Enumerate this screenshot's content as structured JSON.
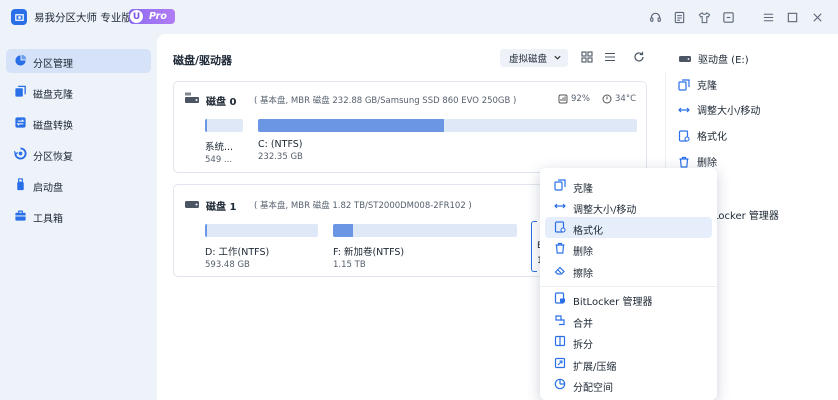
{
  "app": {
    "title": "易我分区大师 专业版",
    "badge_u": "U",
    "badge_text": "Pro"
  },
  "titlebar_icons": [
    "headset-icon",
    "feedback-icon",
    "tshirt-icon",
    "window-icon",
    "menu-icon",
    "minimize-icon",
    "maximize-icon",
    "close-icon"
  ],
  "sidebar": {
    "items": [
      {
        "label": "分区管理",
        "icon": "pie-icon",
        "active": true
      },
      {
        "label": "磁盘克隆",
        "icon": "clone-icon",
        "active": false
      },
      {
        "label": "磁盘转换",
        "icon": "convert-icon",
        "active": false
      },
      {
        "label": "分区恢复",
        "icon": "recover-icon",
        "active": false
      },
      {
        "label": "启动盘",
        "icon": "usb-icon",
        "active": false
      },
      {
        "label": "工具箱",
        "icon": "toolbox-icon",
        "active": false
      }
    ]
  },
  "main": {
    "title": "磁盘/驱动器",
    "view_select": "虚拟磁盘"
  },
  "disks": [
    {
      "name": "磁盘 0",
      "info": "( 基本盘, MBR 磁盘 232.88 GB/Samsung SSD 860 EVO 250GB )",
      "health": "92%",
      "temp": "34°C",
      "partitions": [
        {
          "name": "系统...",
          "size": "549 ...",
          "used": 0.05
        },
        {
          "name": "C: (NTFS)",
          "size": "232.35 GB",
          "used": 0.49
        }
      ]
    },
    {
      "name": "磁盘 1",
      "info": "( 基本盘, MBR 磁盘 1.82 TB/ST2000DM008-2FR102 )",
      "partitions": [
        {
          "name": "D: 工作(NTFS)",
          "size": "593.48 GB",
          "used": 0.02
        },
        {
          "name": "F: 新加卷(NTFS)",
          "size": "1.15 TB",
          "used": 0.11
        }
      ],
      "partial_partition": {
        "name": "E",
        "size": "1"
      }
    }
  ],
  "right_panel": {
    "header": "驱动盘 (E:)",
    "items": [
      {
        "label": "克隆",
        "icon": "clone-icon"
      },
      {
        "label": "调整大小/移动",
        "icon": "resize-icon"
      },
      {
        "label": "格式化",
        "icon": "format-icon"
      },
      {
        "label": "删除",
        "icon": "delete-icon"
      },
      {
        "label": "t",
        "icon": ""
      },
      {
        "label": "Locker 管理器",
        "icon": ""
      }
    ]
  },
  "context_menu": {
    "items": [
      {
        "label": "克隆",
        "icon": "clone-icon"
      },
      {
        "label": "调整大小/移动",
        "icon": "resize-icon"
      },
      {
        "label": "格式化",
        "icon": "format-icon",
        "highlighted": true
      },
      {
        "label": "删除",
        "icon": "delete-icon"
      },
      {
        "label": "擦除",
        "icon": "eraser-icon"
      },
      {
        "label": "BitLocker 管理器",
        "icon": "bitlocker-icon"
      },
      {
        "label": "合并",
        "icon": "merge-icon"
      },
      {
        "label": "拆分",
        "icon": "split-icon"
      },
      {
        "label": "扩展/压缩",
        "icon": "extend-icon"
      },
      {
        "label": "分配空间",
        "icon": "allocate-icon"
      }
    ]
  },
  "colors": {
    "accent": "#2a6fe8",
    "bar_fill": "#6b96e4",
    "bar_track": "#dfe8f6",
    "sidebar_active": "#d6e2f7",
    "menu_highlight": "#e6eefb"
  }
}
